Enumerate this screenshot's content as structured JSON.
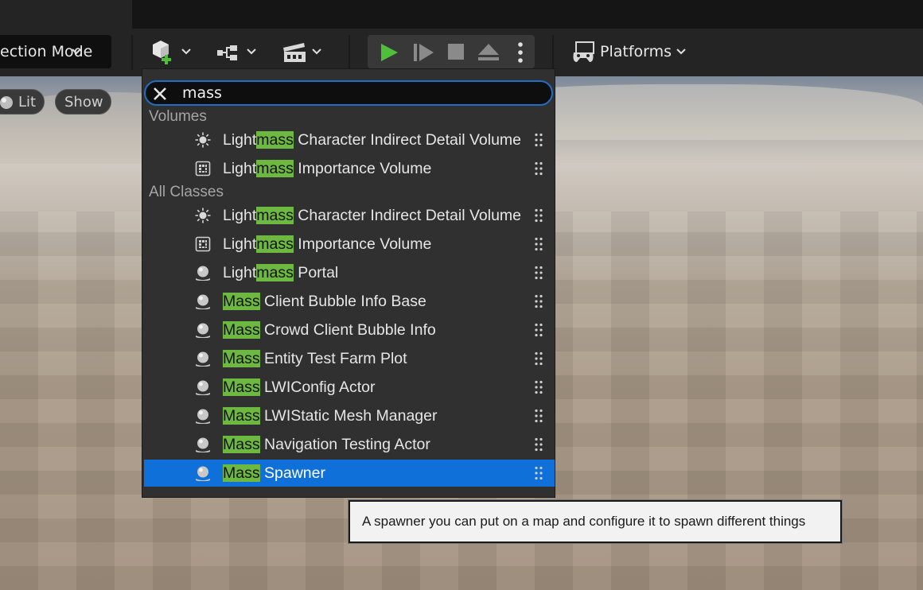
{
  "toolbar": {
    "selection_mode_label": "ection Mode",
    "platforms_label": "Platforms",
    "icons": [
      "add-actor-icon",
      "blueprint-icon",
      "cinematics-icon",
      "play-icon",
      "advance-frame-icon",
      "stop-icon",
      "eject-icon",
      "more-options-icon",
      "platforms-icon"
    ]
  },
  "viewport": {
    "lit_label": "Lit",
    "show_label": "Show"
  },
  "search": {
    "value": "mass"
  },
  "sections": {
    "volumes": "Volumes",
    "all_classes": "All Classes"
  },
  "volumes_items": [
    {
      "pre": "Light",
      "hl": "mass",
      "post": " Character Indirect Detail Volume",
      "icon": "sun-burst-icon"
    },
    {
      "pre": "Light",
      "hl": "mass",
      "post": " Importance Volume",
      "icon": "volume-grid-icon"
    }
  ],
  "class_items": [
    {
      "pre": "Light",
      "hl": "mass",
      "post": " Character Indirect Detail Volume",
      "icon": "sun-burst-icon"
    },
    {
      "pre": "Light",
      "hl": "mass",
      "post": " Importance Volume",
      "icon": "volume-grid-icon"
    },
    {
      "pre": "Light",
      "hl": "mass",
      "post": " Portal",
      "icon": "actor-sphere-icon"
    },
    {
      "pre": "",
      "hl": "Mass",
      "post": " Client Bubble Info Base",
      "icon": "actor-sphere-icon"
    },
    {
      "pre": "",
      "hl": "Mass",
      "post": " Crowd Client Bubble Info",
      "icon": "actor-sphere-icon"
    },
    {
      "pre": "",
      "hl": "Mass",
      "post": " Entity Test Farm Plot",
      "icon": "actor-sphere-icon"
    },
    {
      "pre": "",
      "hl": "Mass",
      "post": " LWIConfig Actor",
      "icon": "actor-sphere-icon"
    },
    {
      "pre": "",
      "hl": "Mass",
      "post": " LWIStatic Mesh Manager",
      "icon": "actor-sphere-icon"
    },
    {
      "pre": "",
      "hl": "Mass",
      "post": " Navigation Testing Actor",
      "icon": "actor-sphere-icon"
    },
    {
      "pre": "",
      "hl": "Mass",
      "post": " Spawner",
      "icon": "actor-sphere-icon",
      "selected": true
    }
  ],
  "tooltip": {
    "text": "A spawner you can put on a map and configure it to spawn different things"
  },
  "colors": {
    "highlight": "#6cb840",
    "selection": "#0e70d8",
    "play_green": "#4fbf3a",
    "search_border": "#1f6ec7"
  }
}
